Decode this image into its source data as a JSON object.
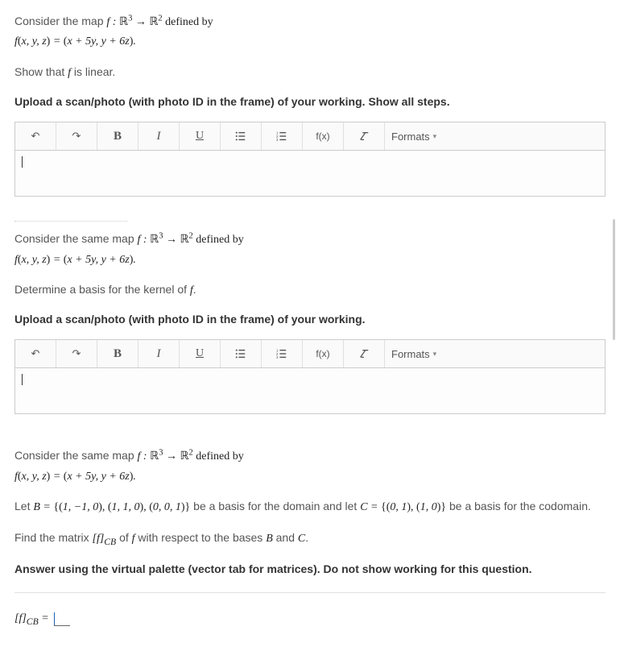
{
  "q1": {
    "prompt_a": "Consider the map ",
    "map_def": "f : ℝ³ → ℝ² defined by",
    "formula": "f(x, y, z) = (x + 5y, y + 6z).",
    "task": "Show that f is linear.",
    "upload": "Upload a scan/photo (with photo ID in the frame) of your working. Show all steps."
  },
  "q2": {
    "prompt_a": "Consider the same map ",
    "map_def": "f : ℝ³ → ℝ² defined by",
    "formula": "f(x, y, z) = (x + 5y, y + 6z).",
    "task": "Determine a basis for the kernel of f.",
    "upload": "Upload a scan/photo (with photo ID in the frame) of your working."
  },
  "q3": {
    "prompt_a": "Consider the same map ",
    "map_def": "f : ℝ³ → ℝ² defined by",
    "formula": "f(x, y, z) = (x + 5y, y + 6z).",
    "basis_line_a": "Let ",
    "basis_B": "B = {(1, −1, 0), (1, 1, 0), (0, 0, 1)}",
    "basis_line_b": " be a basis for the domain and let ",
    "basis_C": "C = {(0, 1), (1, 0)}",
    "basis_line_c": " be a basis for the codomain.",
    "task": "Find the matrix [f]_CB of f with respect to the bases B and C.",
    "instr": "Answer using the virtual palette (vector tab for matrices). Do not show working for this question.",
    "answer_label": "[f]_CB ="
  },
  "toolbar": {
    "undo": "↶",
    "redo": "↷",
    "bold": "B",
    "italic": "I",
    "underline": "U",
    "ul": "bullet-list",
    "ol": "number-list",
    "fx": "f(x)",
    "clear": "clear",
    "formats": "Formats"
  }
}
